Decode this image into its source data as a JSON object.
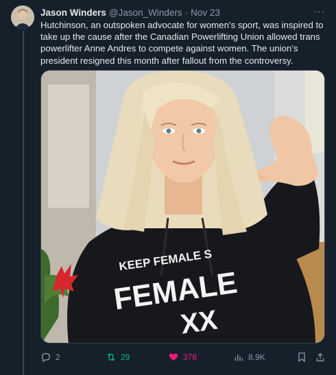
{
  "tweet": {
    "author_name": "Jason Winders",
    "handle": "@Jason_Winders",
    "separator": "·",
    "date": "Nov 23",
    "more_label": "···",
    "text": "Hutchinson, an outspoken advocate for women’s sport, was inspired to take up the cause after the Canadian Powerlifting Union allowed trans powerlifter Anne Andres to compete against women. The union’s president resigned this month after fallout from the controversy."
  },
  "media": {
    "shirt_line1": "KEEP FEMALE S",
    "shirt_line2": "FEMALE",
    "shirt_line3": "XX"
  },
  "actions": {
    "replies": "2",
    "retweets": "29",
    "likes": "378",
    "views": "8.9K"
  },
  "colors": {
    "background": "#15202b",
    "muted": "#8b98a5",
    "retweet": "#00ba7c",
    "like": "#f91880"
  },
  "icons": {
    "reply": "reply-icon",
    "retweet": "retweet-icon",
    "like": "heart-icon",
    "views": "views-icon",
    "bookmark": "bookmark-icon",
    "share": "share-icon"
  }
}
